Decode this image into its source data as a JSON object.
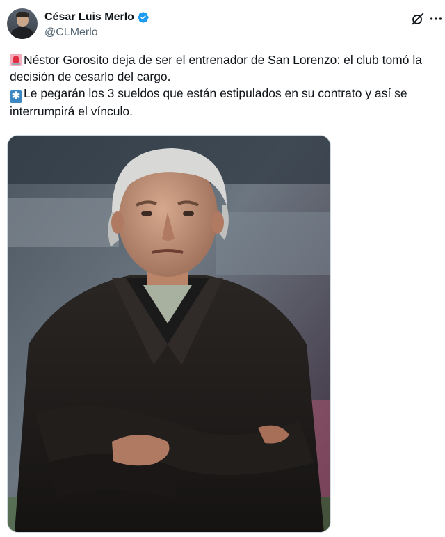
{
  "author": {
    "display_name": "César Luis Merlo",
    "handle": "@CLMerlo",
    "verified": true,
    "verified_color": "#1d9bf0"
  },
  "icons": {
    "avatar": "profile-photo",
    "verified": "verified-badge-icon",
    "grok": "grok-icon",
    "more": "more-options-icon",
    "emoji_1": "police-siren-emoji",
    "emoji_2": "asterisk-emoji"
  },
  "tweet": {
    "paragraph_1": "Néstor Gorosito deja de ser el entrenador de San Lorenzo: el club tomó la decisión de cesarlo del cargo.",
    "paragraph_2": "Le pegarán los 3 sueldos que están estipulados en su contrato y así se interrumpirá el vínculo."
  },
  "media": {
    "type": "photo",
    "subject": "portrait-photo"
  },
  "colors": {
    "text_primary": "#0f1419",
    "text_secondary": "#536471",
    "border": "#cfd9de"
  }
}
